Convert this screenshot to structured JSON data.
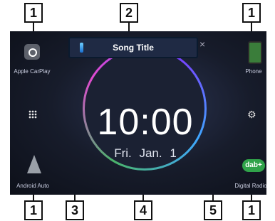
{
  "callouts": {
    "c1": "1",
    "c2": "2",
    "c3": "3",
    "c4": "4",
    "c5": "5"
  },
  "now_playing": {
    "title": "Song Title"
  },
  "clock": {
    "time": "10:00",
    "date": "Fri.  Jan.  1"
  },
  "apps": {
    "carplay": "Apple CarPlay",
    "phone": "Phone",
    "android": "Android Auto",
    "dab": "Digital Radio",
    "dab_badge": "dab+"
  },
  "colors": {
    "ring_green": "#4ab36a",
    "ring_magenta": "#e14bd0",
    "dab_green": "#30a34a"
  }
}
